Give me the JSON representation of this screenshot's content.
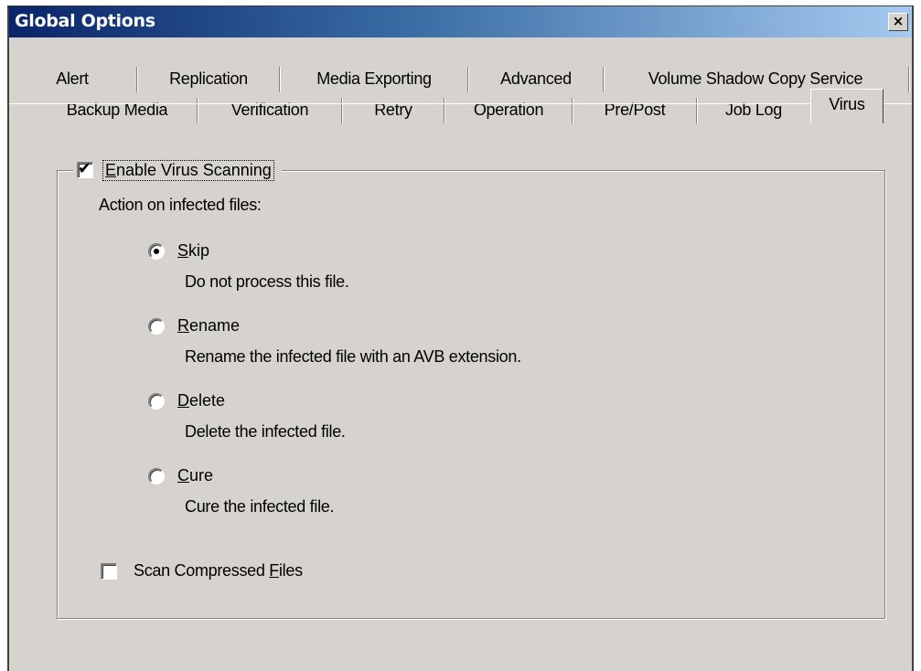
{
  "window": {
    "title": "Global Options",
    "close_glyph": "×",
    "close_icon": "close-icon"
  },
  "tabs": {
    "row1": [
      "Alert",
      "Replication",
      "Media Exporting",
      "Advanced",
      "Volume Shadow Copy Service"
    ],
    "row2": [
      "Backup Media",
      "Verification",
      "Retry",
      "Operation",
      "Pre/Post",
      "Job Log",
      "Virus"
    ],
    "active": "Virus"
  },
  "virus": {
    "enable": {
      "checked": true,
      "mnemonic": "E",
      "rest": "nable Virus Scanning"
    },
    "action_label": "Action on infected files:",
    "options": [
      {
        "mnemonic": "S",
        "rest": "kip",
        "desc": "Do not process this file.",
        "selected": true
      },
      {
        "mnemonic": "R",
        "rest": "ename",
        "desc": "Rename the infected file with an AVB extension.",
        "selected": false
      },
      {
        "mnemonic": "D",
        "rest": "elete",
        "desc": "Delete the infected file.",
        "selected": false
      },
      {
        "mnemonic": "C",
        "rest": "ure",
        "desc": "Cure the infected file.",
        "selected": false
      }
    ],
    "scan_compressed": {
      "checked": false,
      "prefix": "Scan Compressed ",
      "mnemonic": "F",
      "rest": "iles"
    }
  },
  "colors": {
    "dialog_face": "#d6d3ce",
    "title_start": "#0a246a",
    "title_end": "#a6caf0"
  }
}
